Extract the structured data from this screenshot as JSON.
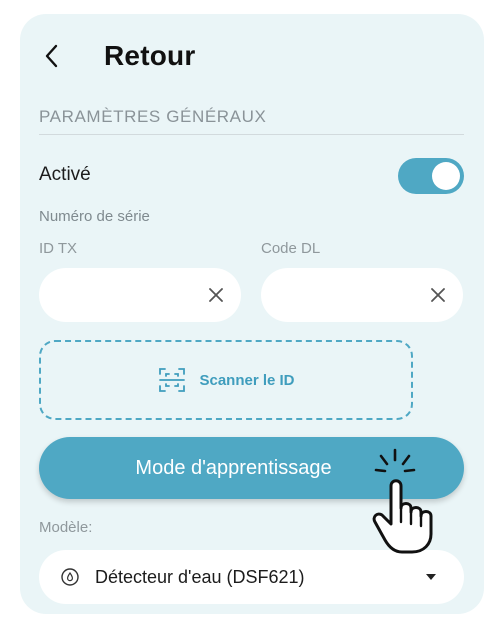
{
  "header": {
    "back_icon": "chevron-left-icon",
    "title": "Retour"
  },
  "general_settings": {
    "section_title": "PARAMÈTRES GÉNÉRAUX",
    "active_label": "Activé",
    "active_enabled": true,
    "serial_number_label": "Numéro de série",
    "id_tx": {
      "label": "ID TX",
      "value": "",
      "clear_icon": "close-icon"
    },
    "code_dl": {
      "label": "Code DL",
      "value": "",
      "clear_icon": "close-icon"
    },
    "scan": {
      "icon": "scan-frame-icon",
      "label": "Scanner le ID"
    },
    "learning_mode_button": "Mode d'apprentissage",
    "model": {
      "label": "Modèle:",
      "icon": "water-sensor-icon",
      "selected": "Détecteur d'eau (DSF621)",
      "caret_icon": "caret-down-icon"
    }
  },
  "colors": {
    "card_background": "#eaf5f7",
    "accent": "#4fa8c4",
    "muted_text": "#8f989c"
  }
}
